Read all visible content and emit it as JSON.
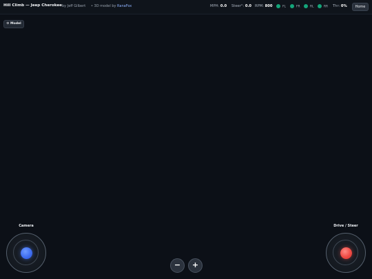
{
  "header": {
    "title": "Hill Climb — Jeep Cherokee",
    "author": "by Jeff Gilbert",
    "model_prefix": "• 3D model by",
    "model_author": "RanaFox",
    "stats": {
      "mph_label": "MPH:",
      "mph_value": "0.0",
      "steer_label": "Steer°:",
      "steer_value": "0.0",
      "rpm_label": "RPM:",
      "rpm_value": "800",
      "throttle_label": "Thr:",
      "throttle_value": "0%"
    },
    "wheels": [
      {
        "label": "FL",
        "color": "#14a57a"
      },
      {
        "label": "FR",
        "color": "#14a57a"
      },
      {
        "label": "RL",
        "color": "#14a57a"
      },
      {
        "label": "RR",
        "color": "#14a57a"
      }
    ],
    "home_label": "Home"
  },
  "model_button": {
    "label": "⚙ Model"
  },
  "controls": {
    "camera_label": "Camera",
    "drive_label": "Drive / Steer",
    "zoom_out_label": "−",
    "zoom_in_label": "+"
  },
  "colors": {
    "background": "#0c1017",
    "camera_knob": "#3f6ef0",
    "drive_knob": "#ef4a44",
    "wheel_ok": "#14a57a"
  }
}
